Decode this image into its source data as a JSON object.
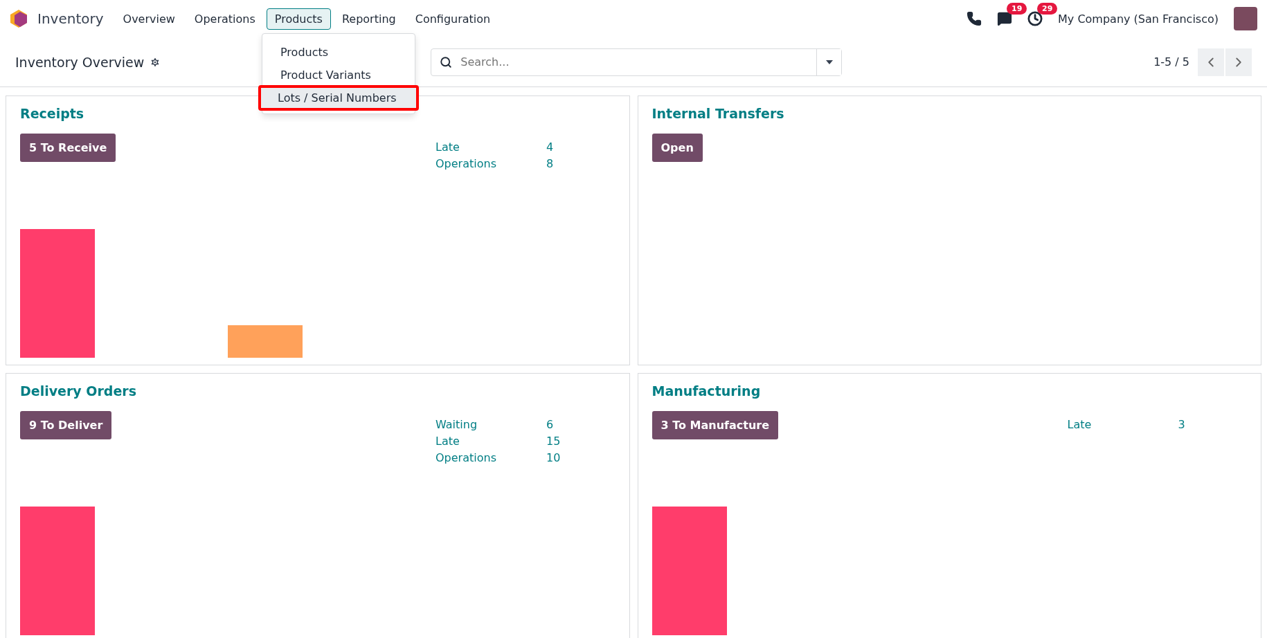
{
  "navbar": {
    "app_name": "Inventory",
    "menus": [
      {
        "label": "Overview",
        "selected": false
      },
      {
        "label": "Operations",
        "selected": false
      },
      {
        "label": "Products",
        "selected": true
      },
      {
        "label": "Reporting",
        "selected": false
      },
      {
        "label": "Configuration",
        "selected": false
      }
    ],
    "chat_badge": "19",
    "activity_badge": "29",
    "company": "My Company (San Francisco)"
  },
  "dropdown": {
    "items": [
      {
        "label": "Products",
        "highlighted": false
      },
      {
        "label": "Product Variants",
        "highlighted": false
      },
      {
        "label": "Lots / Serial Numbers",
        "highlighted": true
      }
    ]
  },
  "control_panel": {
    "title": "Inventory Overview",
    "search": {
      "placeholder": "Search..."
    },
    "pager": "1-5 / 5"
  },
  "cards": [
    {
      "title": "Receipts",
      "button": "5 To Receive",
      "stats": [
        {
          "label": "Late",
          "value": "4"
        },
        {
          "label": "Operations",
          "value": "8"
        }
      ],
      "bars": [
        {
          "color": "#ff3d6b",
          "kind": "tall"
        },
        {
          "color": "#ffa15a",
          "kind": "short"
        }
      ]
    },
    {
      "title": "Internal Transfers",
      "button": "Open"
    },
    {
      "title": "Delivery Orders",
      "button": "9 To Deliver",
      "stats": [
        {
          "label": "Waiting",
          "value": "6"
        },
        {
          "label": "Late",
          "value": "15"
        },
        {
          "label": "Operations",
          "value": "10"
        }
      ],
      "bars": [
        {
          "color": "#ff3d6b",
          "kind": "tall"
        }
      ]
    },
    {
      "title": "Manufacturing",
      "button": "3 To Manufacture",
      "stats": [
        {
          "label": "Late",
          "value": "3"
        }
      ],
      "bars": [
        {
          "color": "#ff3d6b",
          "kind": "tall"
        }
      ]
    }
  ]
}
